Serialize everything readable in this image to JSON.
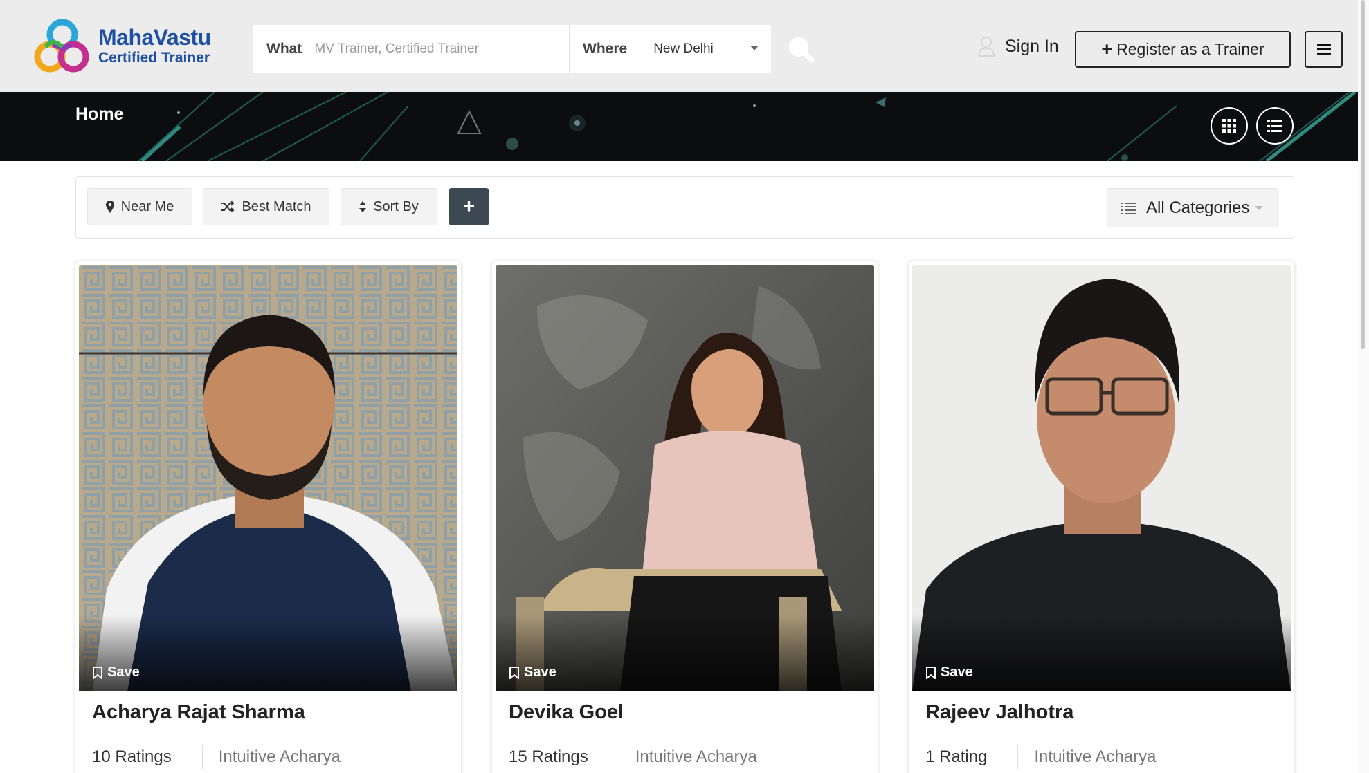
{
  "header": {
    "logo": {
      "title": "MahaVastu",
      "subtitle": "Certified Trainer"
    },
    "search": {
      "what_label": "What",
      "what_placeholder": "MV Trainer, Certified Trainer",
      "where_label": "Where",
      "where_value": "New Delhi"
    },
    "sign_in_label": "Sign In",
    "register_label": "Register as a Trainer"
  },
  "banner": {
    "title": "Home"
  },
  "filters": {
    "near_me": "Near Me",
    "best_match": "Best Match",
    "sort_by": "Sort By",
    "category": "All Categories"
  },
  "save_label": "Save",
  "trainers": [
    {
      "name": "Acharya Rajat Sharma",
      "ratings": "10 Ratings",
      "category": "Intuitive Acharya"
    },
    {
      "name": "Devika Goel",
      "ratings": "15 Ratings",
      "category": "Intuitive Acharya"
    },
    {
      "name": "Rajeev Jalhotra",
      "ratings": "1 Rating",
      "category": "Intuitive Acharya"
    }
  ],
  "colors": {
    "brand_blue": "#1d4fa3",
    "banner_bg": "#0b0d0e",
    "plus_button": "#3c4852"
  }
}
